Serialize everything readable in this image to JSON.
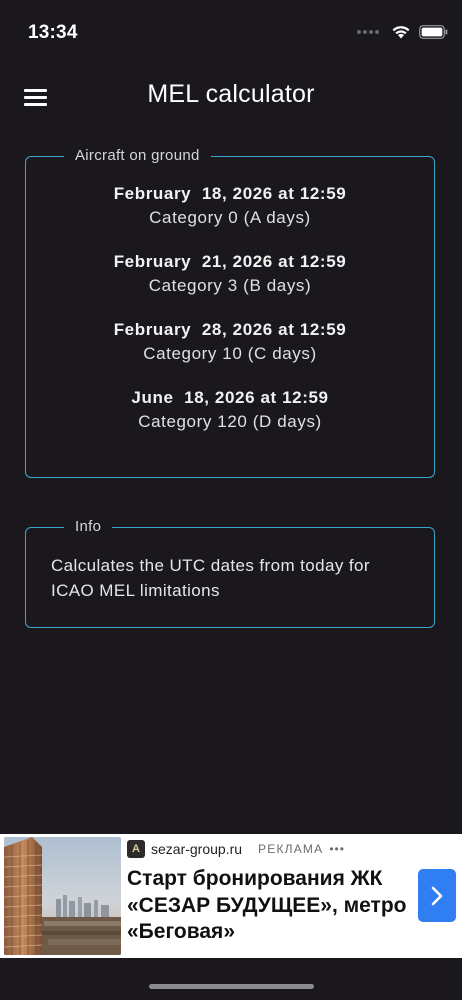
{
  "status_bar": {
    "time": "13:34"
  },
  "header": {
    "title": "MEL calculator",
    "menu_icon": "hamburger-menu-icon"
  },
  "ground_card": {
    "legend": "Aircraft on ground",
    "entries": [
      {
        "date": "February  18, 2026 at 12:59",
        "category": "Category 0 (A days)"
      },
      {
        "date": "February  21, 2026 at 12:59",
        "category": "Category 3 (B days)"
      },
      {
        "date": "February  28, 2026 at 12:59",
        "category": "Category 10 (C days)"
      },
      {
        "date": "June  18, 2026 at 12:59",
        "category": "Category 120 (D days)"
      }
    ]
  },
  "info_card": {
    "legend": "Info",
    "text": "Calculates the UTC dates from today for ICAO MEL limitations"
  },
  "ad": {
    "domain": "sezar-group.ru",
    "label": "РЕКЛАМА",
    "more": "•••",
    "headline": "Старт бронирования ЖК «СЕЗАР БУДУЩЕЕ», метро «Беговая»",
    "cta_icon": "chevron-right-icon"
  },
  "colors": {
    "background": "#1b181d",
    "card_border": "#3aa6cc",
    "ad_button": "#2f7ef2"
  }
}
